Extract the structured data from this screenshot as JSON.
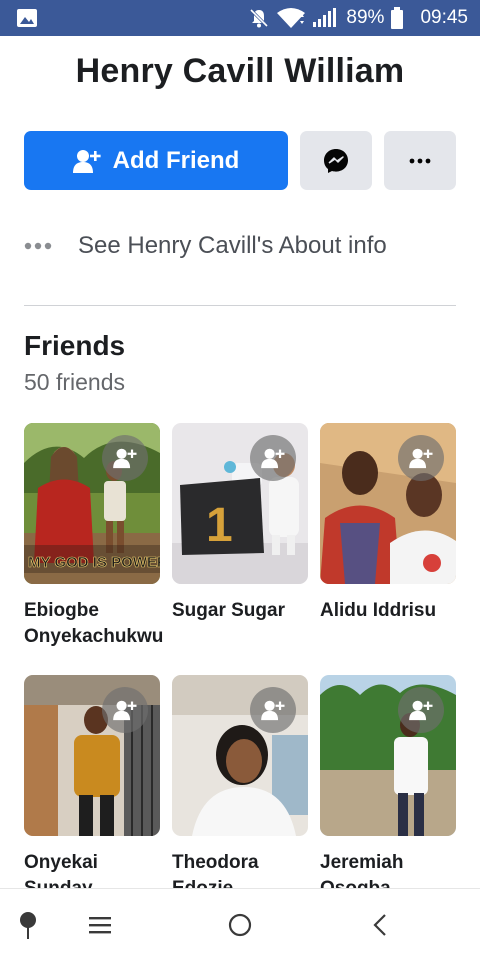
{
  "status_bar": {
    "battery_percent": "89%",
    "time": "09:45"
  },
  "profile": {
    "name": "Henry Cavill William"
  },
  "actions": {
    "add_friend_label": "Add Friend"
  },
  "about": {
    "label": "See Henry Cavill's About info"
  },
  "friends": {
    "title": "Friends",
    "count": "50 friends",
    "items": [
      {
        "name": "Ebiogbe Onyekachukwu",
        "photo_caption": "MY GOD IS POWERF"
      },
      {
        "name": "Sugar Sugar",
        "photo_caption": "1"
      },
      {
        "name": "Alidu Iddrisu"
      },
      {
        "name": "Onyekai Sunday"
      },
      {
        "name": "Theodora Edozie Nwabuokei"
      },
      {
        "name": "Jeremiah Osogba"
      }
    ]
  },
  "colors": {
    "status_bar": "#3b5998",
    "primary_button": "#1877f2",
    "secondary_button": "#e4e6eb"
  },
  "icons": {
    "status": [
      "image-icon",
      "mute-icon",
      "wifi-icon",
      "signal-icon",
      "battery-icon"
    ],
    "actions": [
      "add-user-icon",
      "messenger-icon",
      "more-dots-icon"
    ],
    "nav": [
      "pin-icon",
      "menu-icon",
      "home-circle-icon",
      "back-icon"
    ]
  }
}
